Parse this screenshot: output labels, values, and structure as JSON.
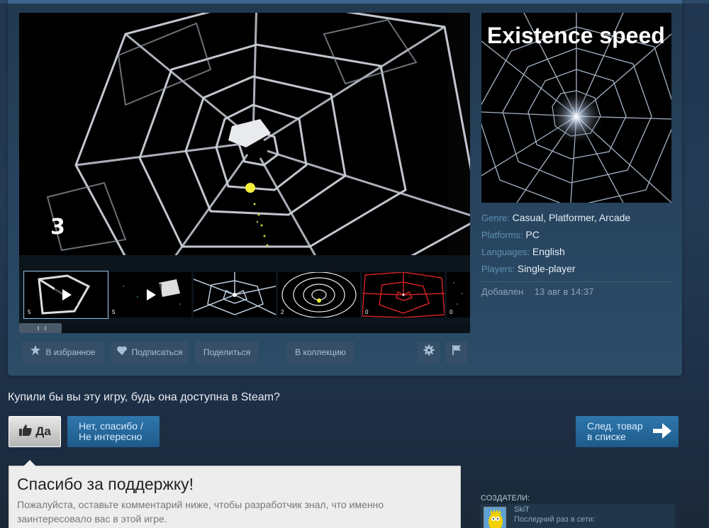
{
  "media": {
    "main_video_number": "3",
    "thumbnails": [
      {
        "num": "5",
        "is_video": true,
        "selected": true
      },
      {
        "num": "5",
        "is_video": true,
        "selected": false
      },
      {
        "num": "",
        "is_video": false,
        "selected": false
      },
      {
        "num": "2",
        "is_video": false,
        "selected": false
      },
      {
        "num": "0",
        "is_video": false,
        "selected": false
      },
      {
        "num": "0",
        "is_video": false,
        "selected": false
      }
    ]
  },
  "capsule": {
    "title": "Existence speed"
  },
  "details": {
    "genre_label": "Genre:",
    "genre_1": "Casual",
    "genre_2": "Platformer",
    "genre_3": "Arcade",
    "platforms_label": "Platforms:",
    "platforms_value": "PC",
    "languages_label": "Languages:",
    "languages_value": "English",
    "players_label": "Players:",
    "players_value": "Single-player",
    "added_label": "Добавлен",
    "added_date": "13 авг в 14:37"
  },
  "actions": {
    "favorite": "В избранное",
    "subscribe": "Подписаться",
    "share": "Поделиться",
    "collection": "В коллекцию"
  },
  "vote": {
    "question": "Купили бы вы эту игру, будь она доступна в Steam?",
    "yes": "Да",
    "no_line1": "Нет, спасибо /",
    "no_line2": "Не интересно",
    "next_line1": "След. товар",
    "next_line2": "в списке"
  },
  "thanks": {
    "title": "Спасибо за поддержку!",
    "text": "Пожалуйста, оставьте комментарий ниже, чтобы разработчик знал, что именно заинтересовало вас в этой игре."
  },
  "creators": {
    "label": "СОЗДАТЕЛИ:",
    "name": "SkiT",
    "status": "Последний раз в сети:"
  },
  "colors": {
    "accent_blue": "#2f77ad",
    "panel_bg": "#2a475e",
    "label_blue": "#5f8fb2"
  }
}
